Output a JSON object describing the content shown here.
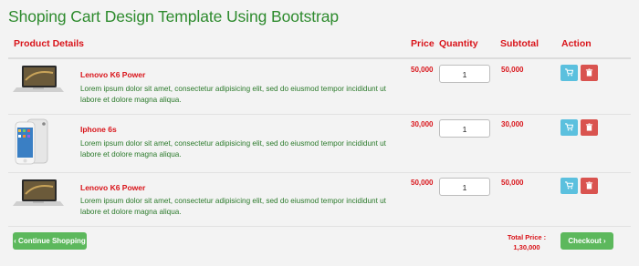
{
  "page_title": "Shoping Cart Design Template Using Bootstrap",
  "headers": {
    "product": "Product Details",
    "price": "Price",
    "quantity": "Quantity",
    "subtotal": "Subtotal",
    "action": "Action"
  },
  "items": [
    {
      "name": "Lenovo K6 Power",
      "description": "Lorem ipsum dolor sit amet, consectetur adipisicing elit, sed do eiusmod tempor incididunt ut labore et dolore magna aliqua.",
      "price": "50,000",
      "quantity": "1",
      "subtotal": "50,000",
      "image": "laptop-image"
    },
    {
      "name": "Iphone 6s",
      "description": "Lorem ipsum dolor sit amet, consectetur adipisicing elit, sed do eiusmod tempor incididunt ut labore et dolore magna aliqua.",
      "price": "30,000",
      "quantity": "1",
      "subtotal": "30,000",
      "image": "phone-image"
    },
    {
      "name": "Lenovo K6 Power",
      "description": "Lorem ipsum dolor sit amet, consectetur adipisicing elit, sed do eiusmod tempor incididunt ut labore et dolore magna aliqua.",
      "price": "50,000",
      "quantity": "1",
      "subtotal": "50,000",
      "image": "laptop-image"
    }
  ],
  "footer": {
    "continue_label": "‹ Continue Shopping",
    "total_label": "Total Price :",
    "total_value": "1,30,000",
    "checkout_label": "Checkout ›"
  },
  "colors": {
    "title": "#2e8b2e",
    "accent_red": "#d9141a",
    "description_green": "#2b7a2b",
    "cart_button": "#5bc0de",
    "delete_button": "#d9534f",
    "green_button": "#5cb85c"
  },
  "icons": {
    "cart_button": "cart-icon",
    "delete_button": "trash-icon"
  }
}
